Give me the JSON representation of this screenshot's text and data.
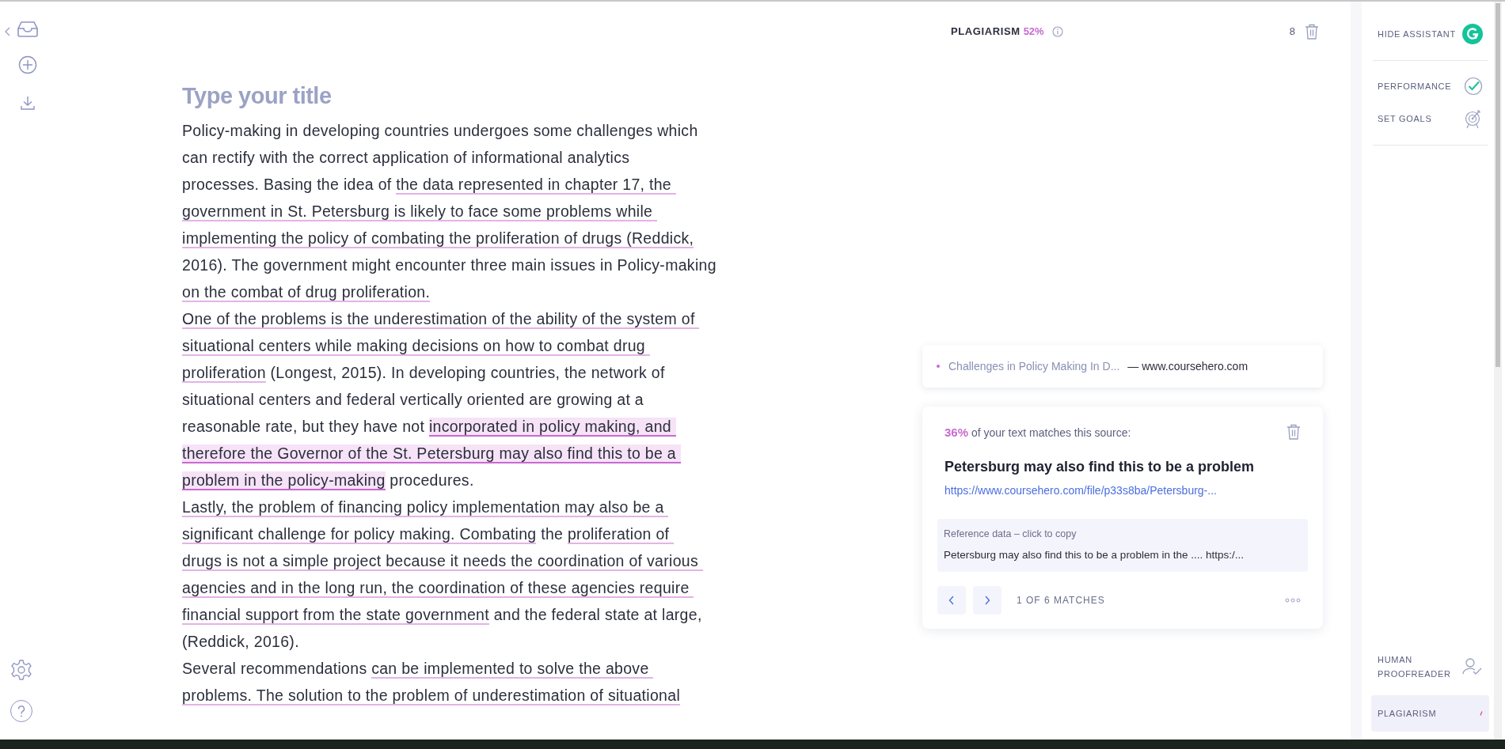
{
  "document": {
    "title_placeholder": "Type your title",
    "paragraphs": [
      [
        [
          {
            "text": "Policy-making in developing countries undergoes some challenges which",
            "underlined": false,
            "active": false
          }
        ],
        [
          {
            "text": "can rectify with the correct application of informational analytics",
            "underlined": false,
            "active": false
          }
        ],
        [
          {
            "text": "processes. Basing the idea of ",
            "underlined": false,
            "active": false
          },
          {
            "text": "the data represented in chapter 17, the ",
            "underlined": true,
            "active": false
          }
        ],
        [
          {
            "text": "government in St. Petersburg is likely to face some problems while ",
            "underlined": true,
            "active": false
          }
        ],
        [
          {
            "text": "implementing the policy of combating the proliferation of drugs (Reddick,",
            "underlined": true,
            "active": false
          }
        ],
        [
          {
            "text": "2016). The government might encounter three main issues in Policy-making",
            "underlined": false,
            "active": false
          }
        ],
        [
          {
            "text": "on the combat of drug proliferation.",
            "underlined": true,
            "active": false
          }
        ]
      ],
      [
        [
          {
            "text": "One of the problems is the underestimation of the ability of the system of ",
            "underlined": true,
            "active": false
          }
        ],
        [
          {
            "text": "situational centers while making decisions on how to combat drug ",
            "underlined": true,
            "active": false
          }
        ],
        [
          {
            "text": "proliferation",
            "underlined": true,
            "active": false
          },
          {
            "text": " (Longest, 2015). In developing countries, the network of",
            "underlined": false,
            "active": false
          }
        ],
        [
          {
            "text": "situational centers and federal vertically oriented are growing at a",
            "underlined": false,
            "active": false
          }
        ],
        [
          {
            "text": "reasonable rate, but they have not ",
            "underlined": false,
            "active": false
          },
          {
            "text": "incorporated in policy making, and ",
            "underlined": true,
            "active": true
          }
        ],
        [
          {
            "text": "therefore the Governor of the St. Petersburg may also find this to be a ",
            "underlined": true,
            "active": true
          }
        ],
        [
          {
            "text": "problem in the policy-making",
            "underlined": true,
            "active": true
          },
          {
            "text": " procedures.",
            "underlined": false,
            "active": false
          }
        ]
      ],
      [
        [
          {
            "text": "Lastly, the problem of financing policy implementation may also be a ",
            "underlined": true,
            "active": false
          }
        ],
        [
          {
            "text": "significant challenge for policy making. Combating",
            "underlined": true,
            "active": false
          },
          {
            "text": " the ",
            "underlined": false,
            "active": false
          },
          {
            "text": "proliferation of ",
            "underlined": true,
            "active": false
          }
        ],
        [
          {
            "text": "drugs is not a simple project because it needs the coordination of various ",
            "underlined": true,
            "active": false
          }
        ],
        [
          {
            "text": "agencies and in the long run, the coordination of these agencies require ",
            "underlined": true,
            "active": false
          }
        ],
        [
          {
            "text": "financial support from the state government",
            "underlined": true,
            "active": false
          },
          {
            "text": " and the federal state at large,",
            "underlined": false,
            "active": false
          }
        ],
        [
          {
            "text": "(Reddick, 2016).",
            "underlined": false,
            "active": false
          }
        ]
      ],
      [
        [
          {
            "text": "Several recommendations ",
            "underlined": false,
            "active": false
          },
          {
            "text": "can be implemented to solve the above ",
            "underlined": true,
            "active": false
          }
        ],
        [
          {
            "text": "problems. The solution to the problem of underestimation of situational",
            "underlined": true,
            "active": false
          }
        ]
      ]
    ]
  },
  "assistant": {
    "header_label": "PLAGIARISM",
    "header_percent": "52%",
    "count": "8",
    "source": {
      "title": "Challenges in Policy Making In D...",
      "site": "— www.coursehero.com",
      "color": "#c86ad0"
    },
    "match": {
      "percent": "36%",
      "percent_text": "of your text matches this source:",
      "title": "Petersburg may also find this to be a problem",
      "url": "https://www.coursehero.com/file/p33s8ba/Petersburg-...",
      "reference_label": "Reference data – click to copy",
      "reference_text": "Petersburg may also find this to be a problem in the .... https:/...",
      "pager": "1 OF 6 MATCHES"
    }
  },
  "sidebar": {
    "top": [
      {
        "label": "HIDE ASSISTANT",
        "kind": "logo",
        "selected": false
      },
      {
        "label": "PERFORMANCE",
        "kind": "check",
        "selected": false
      },
      {
        "label": "SET GOALS",
        "kind": "target",
        "selected": false
      }
    ],
    "bottom": [
      {
        "label": "HUMAN PROOFREADER",
        "kind": "person",
        "selected": false
      },
      {
        "label": "PLAGIARISM",
        "kind": "plagiarism",
        "selected": true
      }
    ]
  }
}
